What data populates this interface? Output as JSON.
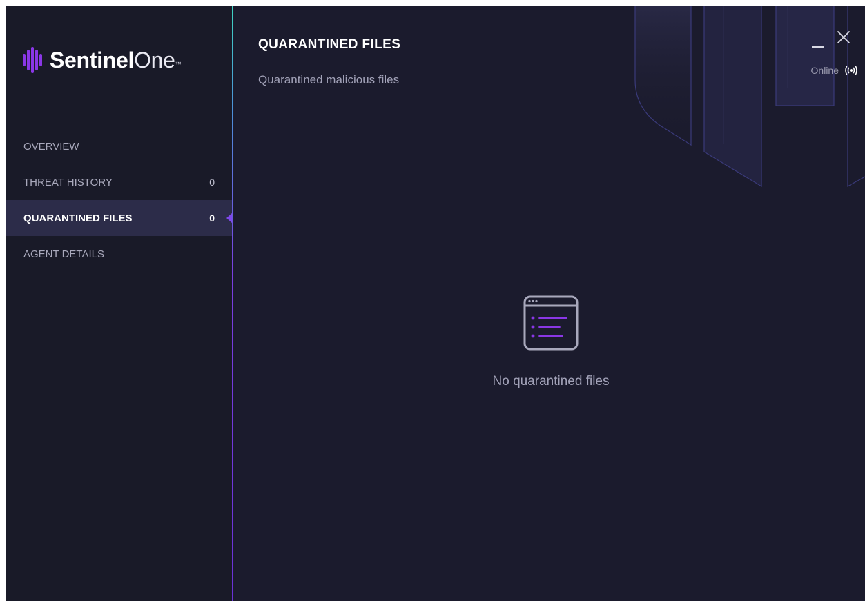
{
  "app": {
    "logo_text_bold": "Sentinel",
    "logo_text_light": "One",
    "logo_mark": "™"
  },
  "sidebar": {
    "items": [
      {
        "label": "OVERVIEW",
        "count": ""
      },
      {
        "label": "THREAT HISTORY",
        "count": "0"
      },
      {
        "label": "QUARANTINED FILES",
        "count": "0",
        "active": true
      },
      {
        "label": "AGENT DETAILS",
        "count": ""
      }
    ]
  },
  "header": {
    "title": "QUARANTINED FILES",
    "subtitle": "Quarantined malicious files",
    "status": "Online"
  },
  "empty_state": {
    "message": "No quarantined files",
    "icon": "file-list-icon"
  },
  "icons": {
    "minimize": "minimize-icon",
    "close": "close-icon",
    "status": "broadcast-icon"
  },
  "colors": {
    "background": "#1b1b2d",
    "sidebar": "#191a28",
    "active_item": "#2c2c49",
    "accent": "#7f48ea",
    "logo_purple": "#8a37e6"
  }
}
